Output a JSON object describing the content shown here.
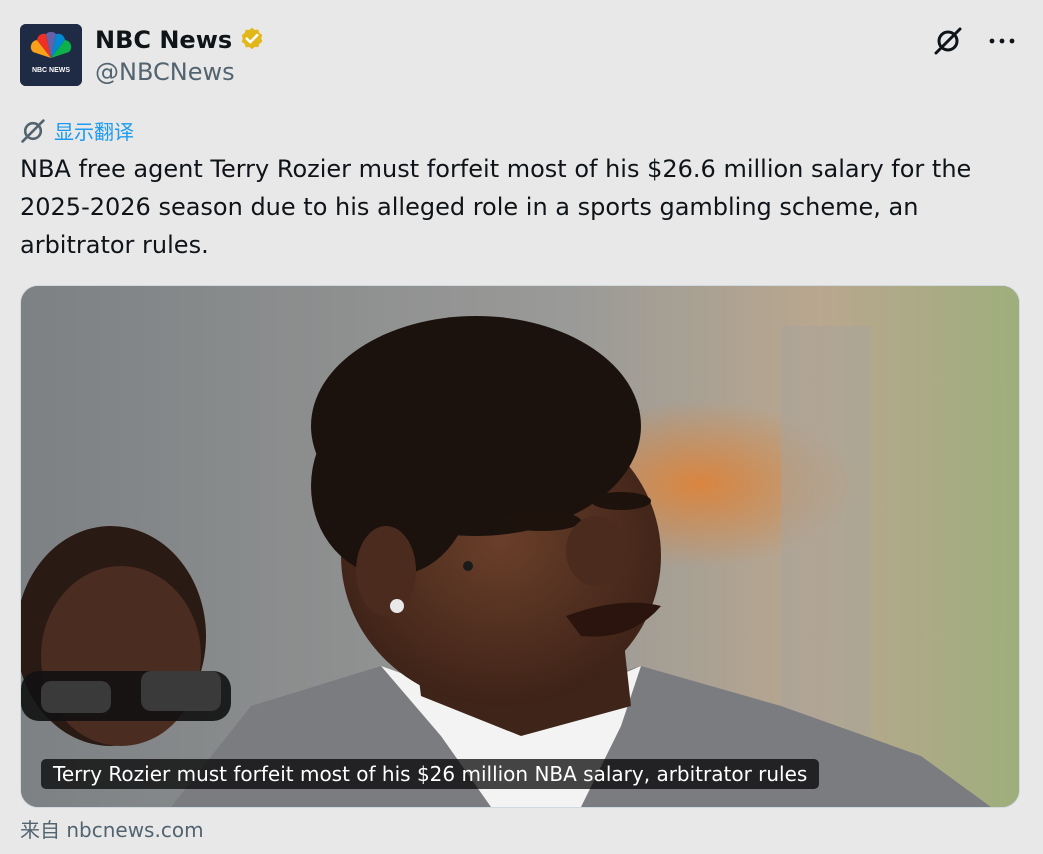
{
  "author": {
    "name": "NBC News",
    "handle": "@NBCNews",
    "avatar_logo_text": "NBC NEWS"
  },
  "translate": {
    "label": "显示翻译"
  },
  "tweet": {
    "text": "NBA free agent Terry Rozier must forfeit most of his $26.6 million salary for the 2025-2026 season due to his alleged role in a sports gambling scheme, an arbitrator rules."
  },
  "card": {
    "caption": "Terry Rozier must forfeit most of his $26 million NBA salary, arbitrator rules"
  },
  "source": {
    "label": "来自 nbcnews.com"
  },
  "icons": {
    "verified": "verified-badge-icon",
    "grok": "grok-icon",
    "more": "more-icon",
    "translate": "translate-icon"
  },
  "colors": {
    "verified_gold": "#e2b719",
    "link_blue": "#1d9bf0",
    "secondary_text": "#536471"
  }
}
